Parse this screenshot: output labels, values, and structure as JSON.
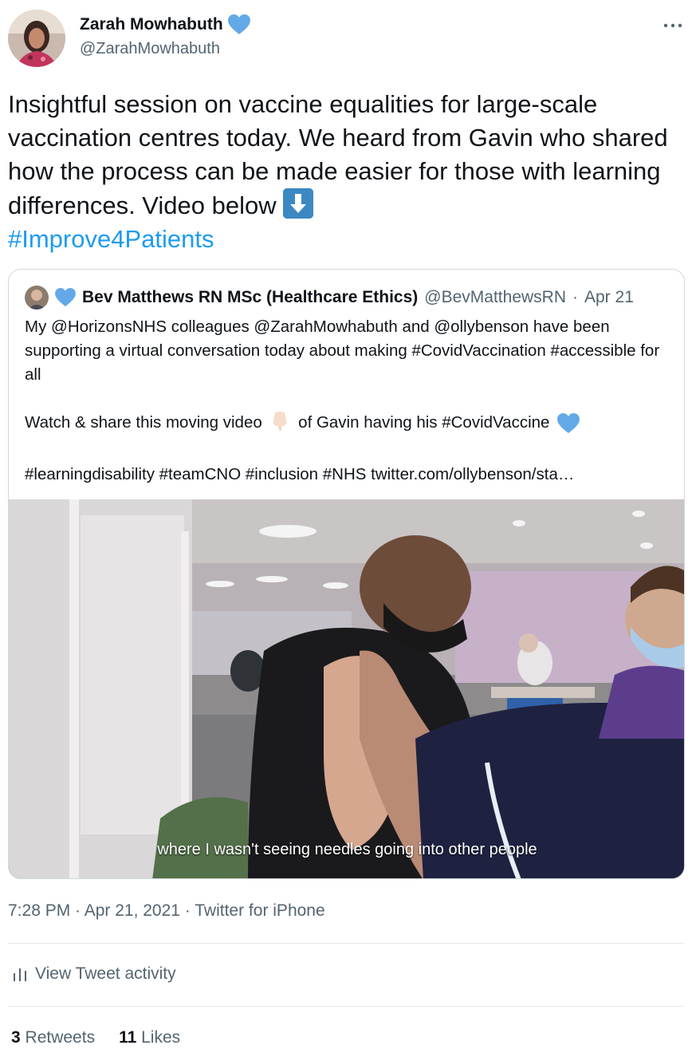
{
  "author": {
    "name": "Zarah Mowhabuth",
    "handle": "@ZarahMowhabuth"
  },
  "tweet": {
    "text": "Insightful session on vaccine equalities for large-scale vaccination centres today. We heard from Gavin who shared how the process can be made easier for those with learning differences. Video below",
    "hashtag": "#Improve4Patients"
  },
  "quote": {
    "name": "Bev Matthews RN MSc (Healthcare Ethics)",
    "handle": "@BevMatthewsRN",
    "separator": "·",
    "date": "Apr 21",
    "para1": "My @HorizonsNHS colleagues @ZarahMowhabuth and @ollybenson have been supporting a virtual conversation today about making #CovidVaccination #accessible for all",
    "para2_a": "Watch & share this moving video",
    "para2_b": "of Gavin having his #CovidVaccine",
    "para3": "#learningdisability #teamCNO #inclusion #NHS  twitter.com/ollybenson/sta…",
    "video_caption": "where I wasn't seeing needles going into other people"
  },
  "meta": {
    "timestamp": "7:28 PM · Apr 21, 2021 · Twitter for iPhone"
  },
  "activity": {
    "label": "View Tweet activity"
  },
  "stats": {
    "retweets_count": "3",
    "retweets_label": "Retweets",
    "likes_count": "11",
    "likes_label": "Likes"
  },
  "colors": {
    "accent": "#1d9bf0",
    "verified": "#63a9e8",
    "secondary_text": "#536471"
  }
}
